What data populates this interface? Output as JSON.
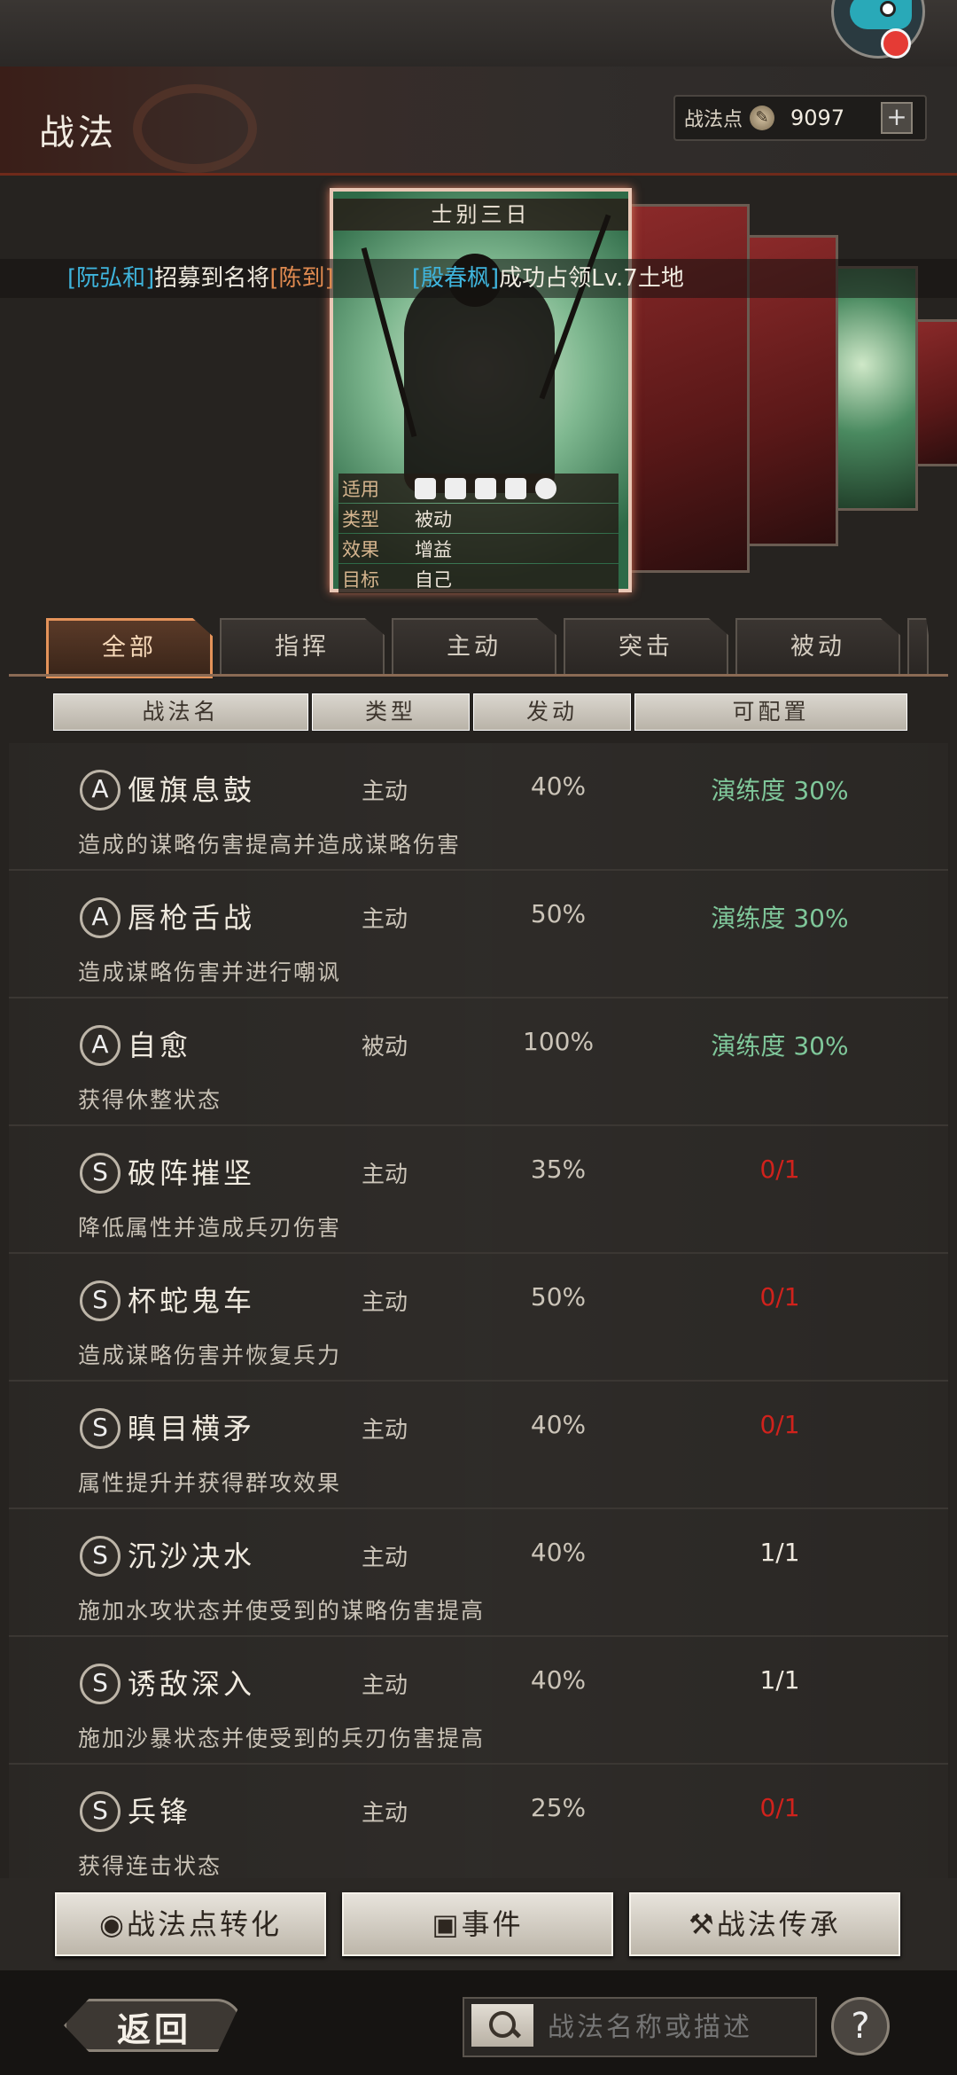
{
  "header": {
    "title": "战法",
    "points_label": "战法点",
    "points_value": "9097",
    "plus_label": "+"
  },
  "featured_card": {
    "title": "士别三日",
    "info": [
      {
        "key": "适用",
        "value": ""
      },
      {
        "key": "类型",
        "value": "被动"
      },
      {
        "key": "效果",
        "value": "增益"
      },
      {
        "key": "目标",
        "value": "自己"
      }
    ],
    "applicable_icons": [
      "cavalry-icon",
      "shield-icon",
      "bow-icon",
      "spear-icon",
      "siege-icon"
    ]
  },
  "ticker": {
    "part1_name": "[阮弘和]",
    "part1_text": "招募到名将",
    "part1_target": "[陈到]",
    "part2_name": "[殷春枫]",
    "part2_text": "成功占领Lv.7土地"
  },
  "tabs": [
    {
      "label": "全部",
      "active": true
    },
    {
      "label": "指挥",
      "active": false
    },
    {
      "label": "主动",
      "active": false
    },
    {
      "label": "突击",
      "active": false
    },
    {
      "label": "被动",
      "active": false
    }
  ],
  "columns": [
    "战法名",
    "类型",
    "发动",
    "可配置"
  ],
  "tactics": [
    {
      "grade": "A",
      "name": "偃旗息鼓",
      "type": "主动",
      "rate": "40%",
      "config": "演练度 30%",
      "config_color": "green",
      "desc": "造成的谋略伤害提高并造成谋略伤害"
    },
    {
      "grade": "A",
      "name": "唇枪舌战",
      "type": "主动",
      "rate": "50%",
      "config": "演练度 30%",
      "config_color": "green",
      "desc": "造成谋略伤害并进行嘲讽"
    },
    {
      "grade": "A",
      "name": "自愈",
      "type": "被动",
      "rate": "100%",
      "config": "演练度 30%",
      "config_color": "green",
      "desc": "获得休整状态"
    },
    {
      "grade": "S",
      "name": "破阵摧坚",
      "type": "主动",
      "rate": "35%",
      "config": "0/1",
      "config_color": "red",
      "desc": "降低属性并造成兵刃伤害"
    },
    {
      "grade": "S",
      "name": "杯蛇鬼车",
      "type": "主动",
      "rate": "50%",
      "config": "0/1",
      "config_color": "red",
      "desc": "造成谋略伤害并恢复兵力"
    },
    {
      "grade": "S",
      "name": "瞋目横矛",
      "type": "主动",
      "rate": "40%",
      "config": "0/1",
      "config_color": "red",
      "desc": "属性提升并获得群攻效果"
    },
    {
      "grade": "S",
      "name": "沉沙决水",
      "type": "主动",
      "rate": "40%",
      "config": "1/1",
      "config_color": "white",
      "desc": "施加水攻状态并使受到的谋略伤害提高"
    },
    {
      "grade": "S",
      "name": "诱敌深入",
      "type": "主动",
      "rate": "40%",
      "config": "1/1",
      "config_color": "white",
      "desc": "施加沙暴状态并使受到的兵刃伤害提高"
    },
    {
      "grade": "S",
      "name": "兵锋",
      "type": "主动",
      "rate": "25%",
      "config": "0/1",
      "config_color": "red",
      "desc": "获得连击状态"
    }
  ],
  "bottom_buttons": {
    "convert": "战法点转化",
    "events": "事件",
    "inherit": "战法传承"
  },
  "nav": {
    "back": "返回",
    "search_placeholder": "战法名称或描述",
    "help": "?"
  }
}
